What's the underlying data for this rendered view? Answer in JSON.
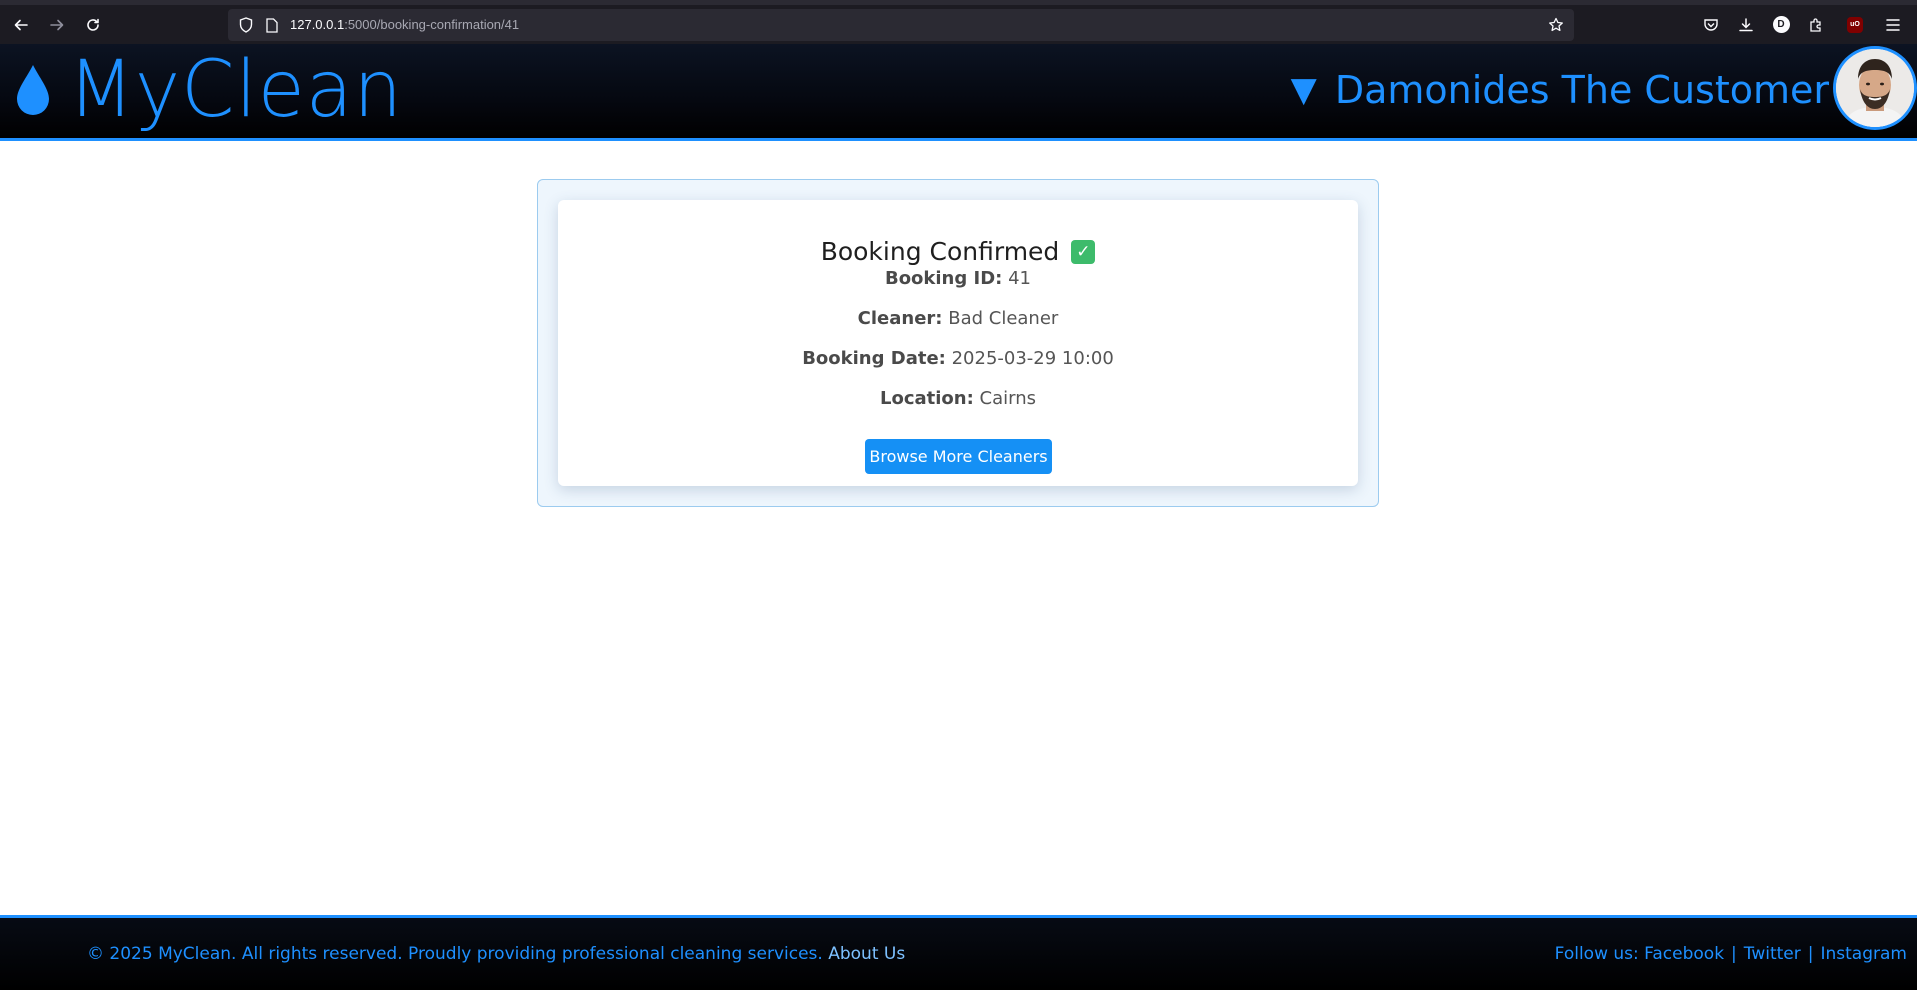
{
  "browser": {
    "url_host": "127.0.0.1",
    "url_path": ":5000/booking-confirmation/41",
    "profile_initial": "D",
    "ublock_label": "uO",
    "icons": [
      "back-arrow-icon",
      "forward-arrow-icon",
      "reload-icon",
      "shield-icon",
      "page-icon",
      "bookmark-star-icon",
      "pocket-icon",
      "download-icon",
      "profile-icon",
      "extensions-icon",
      "ublock-icon",
      "menu-icon"
    ]
  },
  "header": {
    "logo_text": "MyClean",
    "user_arrow": "▼",
    "user_name": "Damonides The Customer",
    "colors": {
      "accent": "#1e90ff",
      "header_bg": "#050810"
    }
  },
  "confirmation": {
    "title": "Booking Confirmed",
    "title_icon": "✓",
    "details": [
      {
        "label": "Booking ID:",
        "value": "41"
      },
      {
        "label": "Cleaner:",
        "value": "Bad Cleaner"
      },
      {
        "label": "Booking Date:",
        "value": "2025-03-29 10:00"
      },
      {
        "label": "Location:",
        "value": "Cairns"
      }
    ],
    "button_label": "Browse More Cleaners",
    "colors": {
      "button": "#1590f5",
      "check": "#3dbb6b"
    }
  },
  "footer": {
    "copyright": "© 2025 MyClean. All rights reserved. Proudly providing professional cleaning services.",
    "about_link": "About Us",
    "follow_label": "Follow us:",
    "social": [
      "Facebook",
      "Twitter",
      "Instagram"
    ],
    "separator": "|"
  }
}
